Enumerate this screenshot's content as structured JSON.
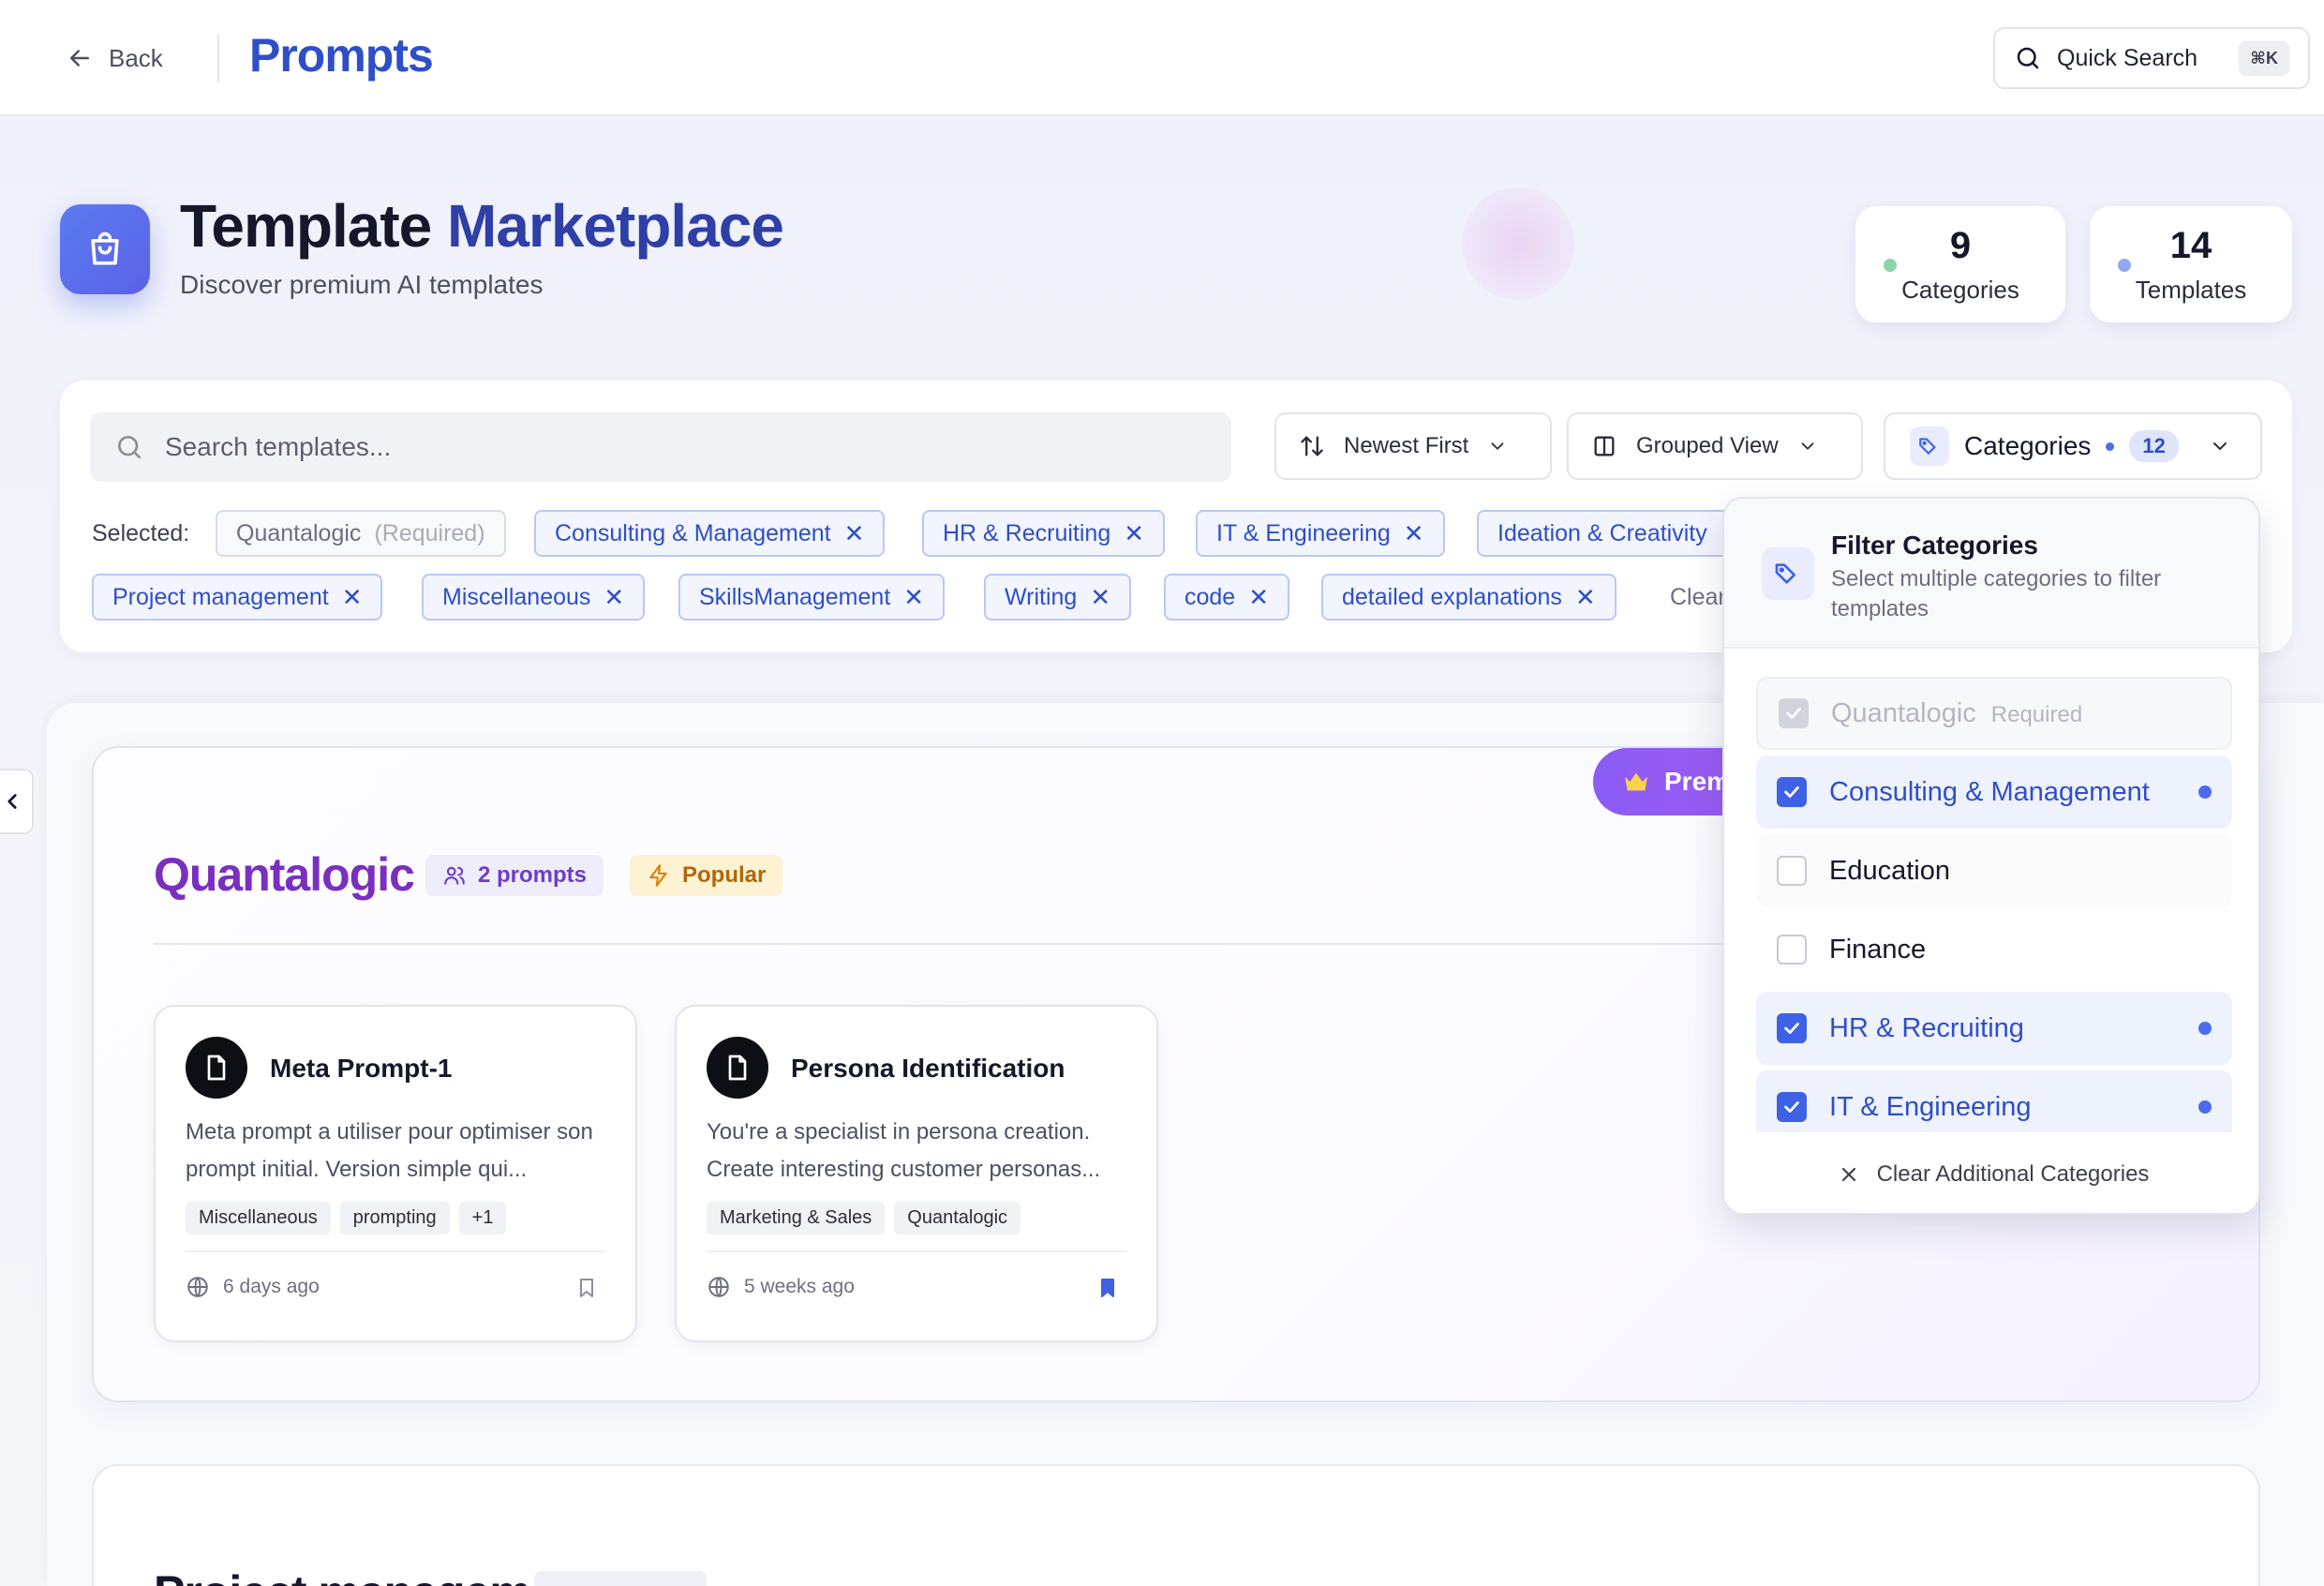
{
  "topbar": {
    "back_label": "Back",
    "title": "Prompts",
    "quick_search_label": "Quick Search",
    "quick_search_shortcut": "⌘K"
  },
  "header": {
    "title_part1": "Template",
    "title_part2": "Marketplace",
    "subtitle": "Discover premium AI templates"
  },
  "stats": [
    {
      "value": "9",
      "label": "Categories",
      "dot_color": "#8fd3a8"
    },
    {
      "value": "14",
      "label": "Templates",
      "dot_color": "#93a8f2"
    }
  ],
  "toolbar": {
    "search_placeholder": "Search templates...",
    "sort_label": "Newest First",
    "view_label": "Grouped View",
    "categories_label": "Categories",
    "categories_count": "12"
  },
  "selected": {
    "label": "Selected:",
    "required_chip": {
      "label": "Quantalogic",
      "note": "(Required)"
    },
    "chips": [
      "Consulting & Management",
      "HR & Recruiting",
      "IT & Engineering",
      "Ideation & Creativity",
      "Project management",
      "Miscellaneous",
      "SkillsManagement",
      "Writing",
      "code",
      "detailed explanations"
    ],
    "clear_label": "Clear"
  },
  "group": {
    "title": "Quantalogic",
    "prompts_badge": "2 prompts",
    "popular_badge": "Popular",
    "premium_label": "Premium",
    "cards": [
      {
        "title": "Meta Prompt-1",
        "description": "Meta prompt a utiliser pour optimiser son prompt initial. Version simple qui...",
        "tags": [
          "Miscellaneous",
          "prompting",
          "+1"
        ],
        "time": "6 days ago",
        "bookmarked": false
      },
      {
        "title": "Persona Identification",
        "description": "You're a specialist in persona creation. Create interesting customer personas...",
        "tags": [
          "Marketing & Sales",
          "Quantalogic"
        ],
        "time": "5 weeks ago",
        "bookmarked": true
      }
    ]
  },
  "group2": {
    "title": "Project management"
  },
  "dropdown": {
    "title": "Filter Categories",
    "subtitle": "Select multiple categories to filter templates",
    "options": [
      {
        "label": "Quantalogic",
        "note": "Required",
        "state": "required"
      },
      {
        "label": "Consulting & Management",
        "state": "checked"
      },
      {
        "label": "Education",
        "state": "unchecked"
      },
      {
        "label": "Finance",
        "state": "unchecked"
      },
      {
        "label": "HR & Recruiting",
        "state": "checked"
      },
      {
        "label": "IT & Engineering",
        "state": "checked"
      }
    ],
    "clear_label": "Clear Additional Categories"
  },
  "colors": {
    "primary": "#2f4ec9",
    "accent_purple": "#8b5cf6",
    "group_title": "#7a2fc0",
    "popular_bg": "#fdf3d2",
    "popular_text": "#b2660c"
  }
}
